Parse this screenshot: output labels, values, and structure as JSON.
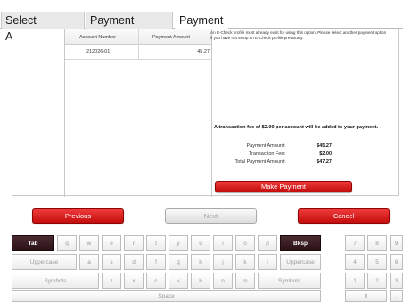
{
  "tabs": [
    "Select Accounts",
    "Payment Amounts",
    "Payment"
  ],
  "table": {
    "headers": [
      "Account Number",
      "Payment Amount"
    ],
    "rows": [
      [
        "212026-01",
        "45.27"
      ]
    ]
  },
  "note": "An E-Check profile must already exist for using this option. Please select another payment option if you have not setup an E-Check profile previously.",
  "fee_note": "A transaction fee of $2.00 per account  will be added to your payment.",
  "summary": [
    {
      "label": "Payment Amount:",
      "value": "$45.27"
    },
    {
      "label": "Transaction Fee:",
      "value": "$2.00"
    },
    {
      "label": "Total Payment Amount:",
      "value": "$47.27"
    }
  ],
  "buttons": {
    "make_payment": "Make Payment",
    "previous": "Previous",
    "next": "Next",
    "cancel": "Cancel"
  },
  "keyboard": {
    "row1": [
      "Tab",
      "q",
      "w",
      "e",
      "r",
      "t",
      "y",
      "u",
      "i",
      "o",
      "p",
      "Bksp"
    ],
    "row2": [
      "Uppercase",
      "a",
      "s",
      "d",
      "f",
      "g",
      "h",
      "j",
      "k",
      "l",
      "Uppercase"
    ],
    "row3": [
      "Symbols",
      "z",
      "x",
      "c",
      "v",
      "b",
      "n",
      "m",
      "Symbols"
    ],
    "row4": [
      "Space"
    ],
    "numpad": [
      "7",
      "8",
      "9",
      "4",
      "5",
      "6",
      "1",
      "2",
      "3",
      "0",
      "."
    ]
  },
  "colors": {
    "accent_red": "#d81b1b",
    "dark_key": "#3a1a20"
  }
}
